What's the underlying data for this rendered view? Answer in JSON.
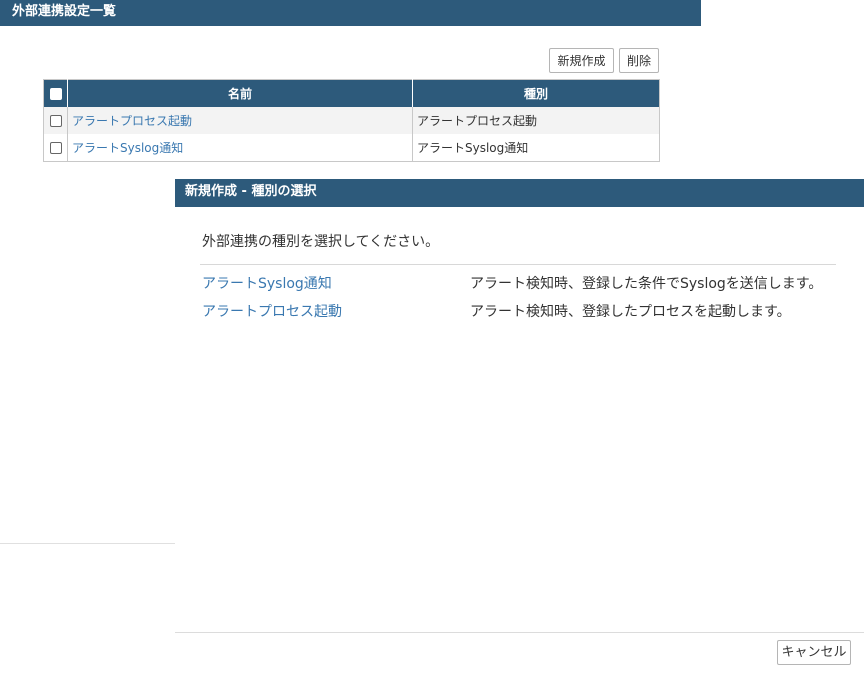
{
  "page": {
    "title": "外部連携設定一覧",
    "new_button": "新規作成",
    "delete_button": "削除"
  },
  "table": {
    "headers": {
      "name": "名前",
      "type": "種別"
    },
    "rows": [
      {
        "name": "アラートプロセス起動",
        "type": "アラートプロセス起動"
      },
      {
        "name": "アラートSyslog通知",
        "type": "アラートSyslog通知"
      }
    ]
  },
  "dialog": {
    "title": "新規作成 - 種別の選択",
    "intro": "外部連携の種別を選択してください。",
    "options": [
      {
        "label": "アラートSyslog通知",
        "description": "アラート検知時、登録した条件でSyslogを送信します。"
      },
      {
        "label": "アラートプロセス起動",
        "description": "アラート検知時、登録したプロセスを起動します。"
      }
    ],
    "cancel_button": "キャンセル"
  },
  "colors": {
    "header_bg": "#2d5a7b",
    "link": "#3a78b0"
  }
}
